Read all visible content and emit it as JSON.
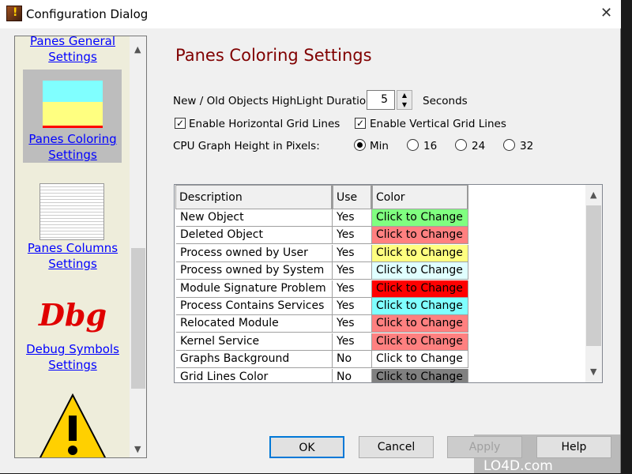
{
  "window": {
    "title": "Configuration Dialog",
    "close": "✕"
  },
  "nav": {
    "items": [
      {
        "label1": "Panes General",
        "label2": "Settings"
      },
      {
        "label1": "Panes Coloring",
        "label2": "Settings",
        "selected": true
      },
      {
        "label1": "Panes Columns",
        "label2": "Settings"
      },
      {
        "label1": "Debug Symbols",
        "label2": "Settings",
        "logo": "Dbg"
      }
    ]
  },
  "page": {
    "heading": "Panes Coloring Settings",
    "duration_label": "New / Old Objects HighLight Duration",
    "duration_value": "5",
    "duration_unit": "Seconds",
    "horizontal_grid": {
      "label": "Enable Horizontal Grid Lines",
      "checked": true
    },
    "vertical_grid": {
      "label": "Enable Vertical Grid Lines",
      "checked": true
    },
    "cpu_label": "CPU Graph Height in Pixels:",
    "cpu_options": [
      "Min",
      "16",
      "24",
      "32"
    ],
    "cpu_selected": "Min"
  },
  "table": {
    "headers": [
      "Description",
      "Use",
      "Color"
    ],
    "rows": [
      {
        "desc": "New Object",
        "use": "Yes",
        "color": "Click to Change",
        "bg": "#80ff80"
      },
      {
        "desc": "Deleted Object",
        "use": "Yes",
        "color": "Click to Change",
        "bg": "#ff8080"
      },
      {
        "desc": "Process owned by User",
        "use": "Yes",
        "color": "Click to Change",
        "bg": "#ffff80"
      },
      {
        "desc": "Process owned by System",
        "use": "Yes",
        "color": "Click to Change",
        "bg": "#e0ffff"
      },
      {
        "desc": "Module Signature Problem",
        "use": "Yes",
        "color": "Click to Change",
        "bg": "#ff0000"
      },
      {
        "desc": "Process Contains Services",
        "use": "Yes",
        "color": "Click to Change",
        "bg": "#80ffff"
      },
      {
        "desc": "Relocated Module",
        "use": "Yes",
        "color": "Click to Change",
        "bg": "#ff8080"
      },
      {
        "desc": "Kernel Service",
        "use": "Yes",
        "color": "Click to Change",
        "bg": "#ff8080"
      },
      {
        "desc": "Graphs Background",
        "use": "No",
        "color": "Click to Change",
        "bg": "#ffffff"
      },
      {
        "desc": "Grid Lines Color",
        "use": "No",
        "color": "Click to Change",
        "bg": "#808080"
      }
    ]
  },
  "buttons": {
    "ok": "OK",
    "cancel": "Cancel",
    "apply": "Apply",
    "help": "Help"
  },
  "watermark": "LO4D.com"
}
